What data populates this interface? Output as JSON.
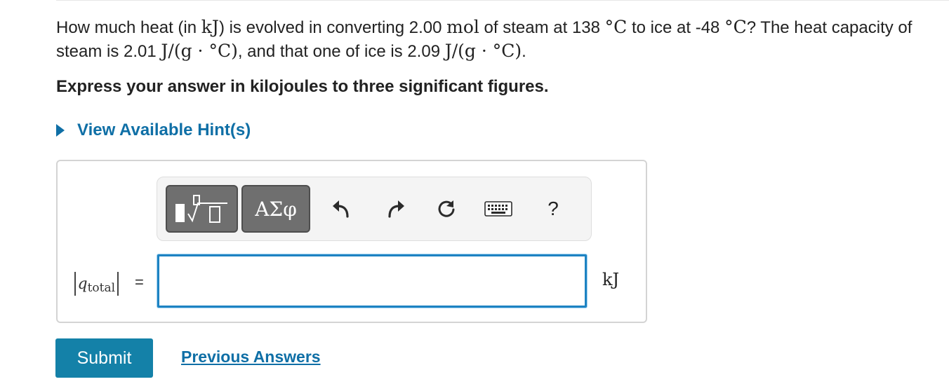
{
  "question": {
    "t1": "How much heat (in ",
    "m1": "kJ",
    "t2": ") is evolved in converting 2.00 ",
    "m2": "mol",
    "t3": " of steam at 138 ",
    "m3": "°C",
    "t4": " to ice at -48 ",
    "m4": "°C",
    "t5": "? The heat capacity of steam is 2.01 ",
    "m5": "J/(g · °C)",
    "t6": ", and that one of ice is 2.09 ",
    "m6": "J/(g · °C)",
    "t7": "."
  },
  "instruction": "Express your answer in kilojoules to three significant figures.",
  "hint": {
    "label": "View Available Hint(s)"
  },
  "toolbar": {
    "templates_icon": "templates-icon",
    "symbols_label": "ΑΣφ",
    "undo_icon": "undo-icon",
    "redo_icon": "redo-icon",
    "reset_icon": "reset-icon",
    "keyboard_icon": "keyboard-icon",
    "help_label": "?"
  },
  "answer": {
    "var_main": "q",
    "var_sub": "total",
    "equals": "=",
    "value": "",
    "unit": "kJ"
  },
  "actions": {
    "submit_label": "Submit",
    "previous_answers_label": "Previous Answers"
  },
  "colors": {
    "accent": "#0f6fa6",
    "submit": "#1481a8",
    "input_border": "#1e83c2",
    "toolbar_button": "#6f6f6f"
  }
}
